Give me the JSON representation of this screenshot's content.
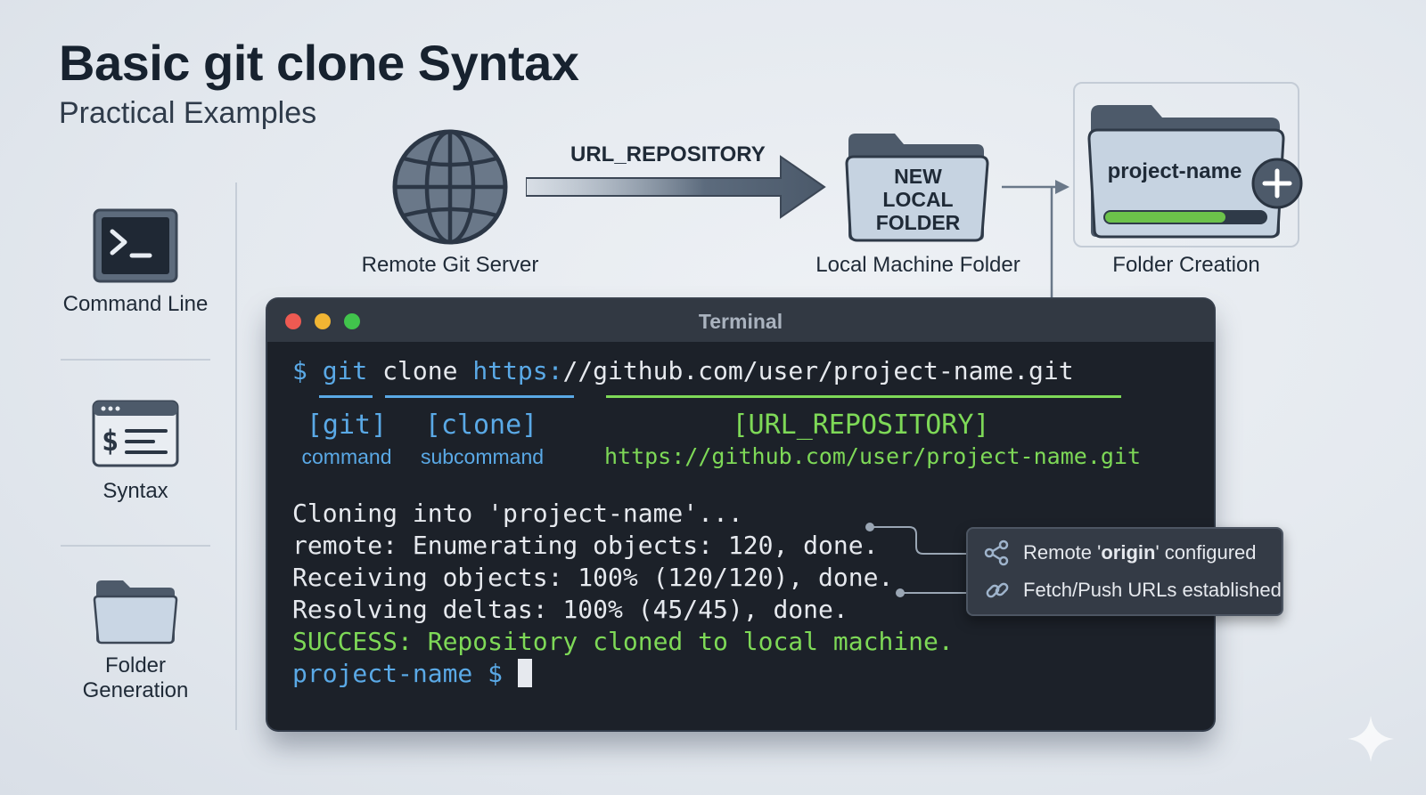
{
  "header": {
    "title": "Basic git clone Syntax",
    "subtitle": "Practical Examples"
  },
  "sidebar": {
    "items": [
      {
        "label": "Command Line",
        "icon": "terminal-icon"
      },
      {
        "label": "Syntax",
        "icon": "syntax-window-icon"
      },
      {
        "label_line1": "Folder",
        "label_line2": "Generation",
        "icon": "folder-icon"
      }
    ]
  },
  "flow": {
    "server_label": "Remote Git Server",
    "arrow_label": "URL_REPOSITORY",
    "local_folder_text": [
      "NEW",
      "LOCAL",
      "FOLDER"
    ],
    "local_folder_label": "Local Machine Folder",
    "project_folder_text": "project-name",
    "project_folder_label": "Folder Creation",
    "progress": 0.75
  },
  "terminal": {
    "title": "Terminal",
    "command": {
      "prompt": "$",
      "git": "git",
      "clone": "clone",
      "url_scheme": "https:",
      "url_rest": "//github.com/user/project-name.git"
    },
    "annotations": {
      "git": {
        "tag": "[git]",
        "desc": "command"
      },
      "clone": {
        "tag": "[clone]",
        "desc": "subcommand"
      },
      "url": {
        "tag": "[URL_REPOSITORY]",
        "desc": "https://github.com/user/project-name.git"
      }
    },
    "output": [
      "Cloning into 'project-name'...",
      "remote: Enumerating objects: 120, done.",
      "Receiving objects: 100% (120/120), done.",
      "Resolving deltas: 100% (45/45), done."
    ],
    "success": "SUCCESS: Repository cloned to local machine.",
    "final_prompt": "project-name $"
  },
  "tooltip": {
    "row1_prefix": "Remote '",
    "row1_bold": "origin",
    "row1_suffix": "' configured",
    "row2": "Fetch/Push URLs established"
  },
  "colors": {
    "prompt_blue": "#5aa9e6",
    "success_green": "#7ed957",
    "terminal_bg": "#1c2129"
  }
}
